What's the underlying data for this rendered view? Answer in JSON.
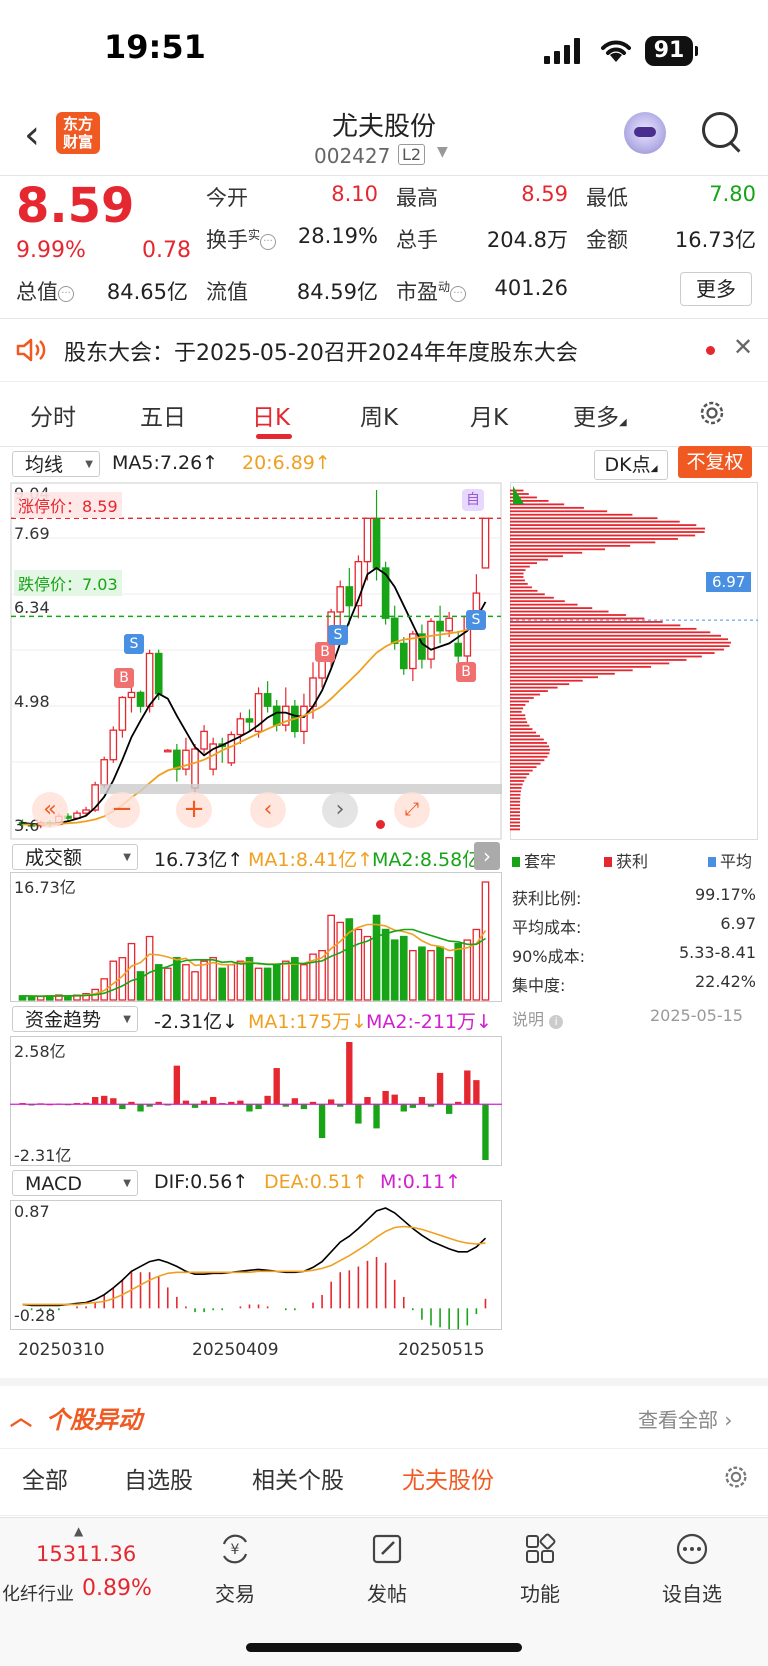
{
  "status_bar": {
    "time": "19:51",
    "battery": "91"
  },
  "header": {
    "logo_text_line1": "东方",
    "logo_text_line2": "财富",
    "stock_name": "尤夫股份",
    "stock_code": "002427",
    "level_badge": "L2"
  },
  "quote": {
    "price": "8.59",
    "change_pct": "9.99%",
    "change": "0.78",
    "open_label": "今开",
    "open_value": "8.10",
    "high_label": "最高",
    "high_value": "8.59",
    "low_label": "最低",
    "low_value": "7.80",
    "turnover_label": "换手",
    "turnover_sup": "实",
    "turnover_value": "28.19%",
    "volume_label": "总手",
    "volume_value": "204.8万",
    "amount_label": "金额",
    "amount_value": "16.73亿",
    "total_mv_label": "总值",
    "total_mv_value": "84.65亿",
    "float_mv_label": "流值",
    "float_mv_value": "84.59亿",
    "pe_label": "市盈",
    "pe_sup": "动",
    "pe_value": "401.26",
    "more_button": "更多"
  },
  "notice": {
    "text": "股东大会：于2025-05-20召开2024年年度股东大会"
  },
  "period_tabs": [
    {
      "label": "分时",
      "active": false
    },
    {
      "label": "五日",
      "active": false
    },
    {
      "label": "日K",
      "active": true
    },
    {
      "label": "周K",
      "active": false
    },
    {
      "label": "月K",
      "active": false
    },
    {
      "label": "更多",
      "active": false
    }
  ],
  "kline": {
    "ma_select": "均线",
    "ma5": "MA5:7.26↑",
    "ma20": "20:6.89↑",
    "dk_select": "DK点",
    "fq_button": "不复权",
    "y_labels": [
      "9.04",
      "7.69",
      "6.34",
      "4.98",
      "3.6"
    ],
    "limit_up_label": "涨停价：8.59",
    "limit_down_label": "跌停价：7.03",
    "self_marker": "自",
    "buy_marker": "B",
    "sell_marker": "S",
    "colors": {
      "up": "#e5272f",
      "down": "#17a417",
      "ma5": "#000000",
      "ma20": "#f0a020"
    }
  },
  "chip_profile": {
    "avg_price_label": "6.97",
    "legend": [
      "套牢",
      "获利",
      "平均"
    ],
    "stats": [
      {
        "label": "获利比例:",
        "value": "99.17%"
      },
      {
        "label": "平均成本:",
        "value": "6.97"
      },
      {
        "label": "90%成本:",
        "value": "5.33-8.41"
      },
      {
        "label": "集中度:",
        "value": "22.42%"
      }
    ],
    "note_label": "说明",
    "date": "2025-05-15"
  },
  "volume_panel": {
    "select": "成交额",
    "value": "16.73亿↑",
    "ma1": "MA1:8.41亿↑",
    "ma2": "MA2:8.58亿↑",
    "max_label": "16.73亿"
  },
  "capital_panel": {
    "select": "资金趋势",
    "value": "-2.31亿↓",
    "ma1": "MA1:175万↓",
    "ma2": "MA2:-211万↓",
    "max_label": "2.58亿",
    "min_label": "-2.31亿"
  },
  "macd_panel": {
    "select": "MACD",
    "dif": "DIF:0.56↑",
    "dea": "DEA:0.51↑",
    "m": "M:0.11↑",
    "max_label": "0.87",
    "min_label": "-0.28"
  },
  "x_axis_dates": [
    "20250310",
    "20250409",
    "20250515"
  ],
  "chart_data": {
    "type": "candlestick",
    "ylim": [
      3.6,
      9.04
    ],
    "candles": [
      {
        "o": 3.75,
        "c": 3.72,
        "h": 3.8,
        "l": 3.66
      },
      {
        "o": 3.72,
        "c": 3.7,
        "h": 3.76,
        "l": 3.65
      },
      {
        "o": 3.7,
        "c": 3.75,
        "h": 3.78,
        "l": 3.66
      },
      {
        "o": 3.75,
        "c": 3.72,
        "h": 3.79,
        "l": 3.68
      },
      {
        "o": 3.72,
        "c": 3.85,
        "h": 3.9,
        "l": 3.7
      },
      {
        "o": 3.85,
        "c": 3.82,
        "h": 3.9,
        "l": 3.78
      },
      {
        "o": 3.82,
        "c": 3.9,
        "h": 3.94,
        "l": 3.8
      },
      {
        "o": 3.9,
        "c": 3.95,
        "h": 4.0,
        "l": 3.86
      },
      {
        "o": 3.95,
        "c": 4.35,
        "h": 4.4,
        "l": 3.92
      },
      {
        "o": 4.35,
        "c": 4.75,
        "h": 4.8,
        "l": 4.3
      },
      {
        "o": 4.75,
        "c": 5.22,
        "h": 5.28,
        "l": 4.7
      },
      {
        "o": 5.22,
        "c": 5.74,
        "h": 5.76,
        "l": 5.1
      },
      {
        "o": 5.74,
        "c": 5.82,
        "h": 6.1,
        "l": 5.5
      },
      {
        "o": 5.82,
        "c": 5.6,
        "h": 5.85,
        "l": 5.5
      },
      {
        "o": 5.6,
        "c": 6.44,
        "h": 6.5,
        "l": 5.5
      },
      {
        "o": 6.44,
        "c": 5.8,
        "h": 6.5,
        "l": 5.7
      },
      {
        "o": 4.9,
        "c": 4.9,
        "h": 4.92,
        "l": 4.88
      },
      {
        "o": 4.9,
        "c": 4.6,
        "h": 5.0,
        "l": 4.4
      },
      {
        "o": 4.6,
        "c": 4.9,
        "h": 5.1,
        "l": 4.5
      },
      {
        "o": 4.3,
        "c": 4.92,
        "h": 5.0,
        "l": 4.2
      },
      {
        "o": 4.92,
        "c": 5.2,
        "h": 5.3,
        "l": 4.85
      },
      {
        "o": 4.6,
        "c": 5.0,
        "h": 5.1,
        "l": 4.5
      },
      {
        "o": 5.0,
        "c": 4.96,
        "h": 5.1,
        "l": 4.7
      },
      {
        "o": 4.7,
        "c": 5.15,
        "h": 5.2,
        "l": 4.65
      },
      {
        "o": 5.15,
        "c": 5.4,
        "h": 5.5,
        "l": 5.0
      },
      {
        "o": 5.4,
        "c": 5.35,
        "h": 5.55,
        "l": 5.2
      },
      {
        "o": 5.2,
        "c": 5.8,
        "h": 5.9,
        "l": 5.1
      },
      {
        "o": 5.8,
        "c": 5.6,
        "h": 6.0,
        "l": 5.5
      },
      {
        "o": 5.6,
        "c": 5.3,
        "h": 5.7,
        "l": 5.2
      },
      {
        "o": 5.3,
        "c": 5.6,
        "h": 5.9,
        "l": 5.2
      },
      {
        "o": 5.6,
        "c": 5.2,
        "h": 5.7,
        "l": 5.1
      },
      {
        "o": 5.2,
        "c": 5.6,
        "h": 5.8,
        "l": 5.0
      },
      {
        "o": 5.6,
        "c": 6.05,
        "h": 6.3,
        "l": 5.4
      },
      {
        "o": 6.05,
        "c": 6.5,
        "h": 6.6,
        "l": 5.9
      },
      {
        "o": 6.5,
        "c": 7.1,
        "h": 7.15,
        "l": 6.2
      },
      {
        "o": 7.1,
        "c": 7.5,
        "h": 7.6,
        "l": 6.8
      },
      {
        "o": 7.5,
        "c": 7.2,
        "h": 7.8,
        "l": 6.9
      },
      {
        "o": 7.2,
        "c": 7.9,
        "h": 8.0,
        "l": 7.0
      },
      {
        "o": 7.9,
        "c": 8.59,
        "h": 8.59,
        "l": 7.6
      },
      {
        "o": 8.59,
        "c": 7.8,
        "h": 9.04,
        "l": 7.6
      },
      {
        "o": 7.8,
        "c": 7.0,
        "h": 7.9,
        "l": 6.9
      },
      {
        "o": 7.0,
        "c": 6.6,
        "h": 7.2,
        "l": 6.5
      },
      {
        "o": 6.6,
        "c": 6.2,
        "h": 6.7,
        "l": 6.1
      },
      {
        "o": 6.2,
        "c": 6.75,
        "h": 6.8,
        "l": 6.0
      },
      {
        "o": 6.75,
        "c": 6.35,
        "h": 6.9,
        "l": 6.2
      },
      {
        "o": 6.35,
        "c": 6.95,
        "h": 7.0,
        "l": 6.2
      },
      {
        "o": 6.95,
        "c": 6.8,
        "h": 7.2,
        "l": 6.6
      },
      {
        "o": 6.8,
        "c": 7.0,
        "h": 7.1,
        "l": 6.7
      },
      {
        "o": 6.6,
        "c": 6.4,
        "h": 6.8,
        "l": 6.3
      },
      {
        "o": 6.4,
        "c": 7.03,
        "h": 7.1,
        "l": 6.3
      },
      {
        "o": 7.03,
        "c": 7.4,
        "h": 7.7,
        "l": 6.9
      },
      {
        "o": 7.8,
        "c": 8.59,
        "h": 8.59,
        "l": 7.8
      }
    ],
    "ma5": [
      3.74,
      3.73,
      3.72,
      3.72,
      3.75,
      3.77,
      3.81,
      3.86,
      3.99,
      4.16,
      4.42,
      4.75,
      5.11,
      5.37,
      5.62,
      5.8,
      5.72,
      5.45,
      5.2,
      4.95,
      4.82,
      4.92,
      4.98,
      5.05,
      5.12,
      5.2,
      5.3,
      5.42,
      5.5,
      5.5,
      5.45,
      5.43,
      5.6,
      5.85,
      6.2,
      6.6,
      6.95,
      7.3,
      7.7,
      7.8,
      7.7,
      7.5,
      7.2,
      6.9,
      6.6,
      6.5,
      6.55,
      6.6,
      6.7,
      6.8,
      7.0,
      7.26
    ],
    "ma20": [
      3.72,
      3.72,
      3.72,
      3.72,
      3.73,
      3.74,
      3.75,
      3.77,
      3.8,
      3.85,
      3.93,
      4.03,
      4.15,
      4.25,
      4.38,
      4.5,
      4.58,
      4.62,
      4.66,
      4.7,
      4.75,
      4.82,
      4.9,
      4.96,
      5.03,
      5.1,
      5.17,
      5.24,
      5.3,
      5.36,
      5.4,
      5.45,
      5.52,
      5.6,
      5.72,
      5.86,
      6.0,
      6.14,
      6.3,
      6.45,
      6.55,
      6.62,
      6.66,
      6.68,
      6.7,
      6.72,
      6.74,
      6.76,
      6.78,
      6.82,
      6.85,
      6.89
    ],
    "amount": [
      0.6,
      0.5,
      0.5,
      0.6,
      0.7,
      0.6,
      0.7,
      0.9,
      1.5,
      3.0,
      5.5,
      6.0,
      8.0,
      4.0,
      9.0,
      5.0,
      4.5,
      6.0,
      5.0,
      4.0,
      5.5,
      6.0,
      4.5,
      5.0,
      5.5,
      6.0,
      4.5,
      4.5,
      5.0,
      5.5,
      6.0,
      5.0,
      6.5,
      7.0,
      12.0,
      11.0,
      11.5,
      10.0,
      9.0,
      12.0,
      10.0,
      8.5,
      9.0,
      7.0,
      7.5,
      7.0,
      7.5,
      6.0,
      8.0,
      8.5,
      10.0,
      16.73
    ],
    "capital": [
      0.05,
      -0.05,
      0.04,
      0.0,
      0.03,
      -0.02,
      0.05,
      0.06,
      0.3,
      0.35,
      0.25,
      -0.2,
      0.1,
      -0.3,
      -0.1,
      0.1,
      -0.05,
      1.6,
      0.15,
      -0.15,
      0.15,
      0.3,
      0.05,
      0.1,
      0.15,
      -0.3,
      -0.2,
      0.35,
      1.5,
      -0.1,
      0.25,
      -0.2,
      0.1,
      -1.4,
      0.2,
      -0.1,
      2.58,
      -0.8,
      0.3,
      -1.0,
      0.55,
      0.4,
      -0.3,
      -0.15,
      0.3,
      -0.1,
      1.3,
      -0.4,
      0.1,
      1.4,
      1.0,
      -2.31
    ],
    "macd_dif": [
      -0.12,
      -0.13,
      -0.13,
      -0.13,
      -0.13,
      -0.12,
      -0.11,
      -0.1,
      -0.07,
      -0.02,
      0.05,
      0.13,
      0.22,
      0.27,
      0.32,
      0.34,
      0.31,
      0.27,
      0.22,
      0.19,
      0.19,
      0.2,
      0.2,
      0.21,
      0.22,
      0.23,
      0.24,
      0.23,
      0.22,
      0.21,
      0.21,
      0.22,
      0.26,
      0.32,
      0.42,
      0.52,
      0.58,
      0.66,
      0.75,
      0.84,
      0.87,
      0.82,
      0.74,
      0.66,
      0.59,
      0.53,
      0.49,
      0.45,
      0.42,
      0.42,
      0.47,
      0.56
    ],
    "macd_dea": [
      -0.12,
      -0.12,
      -0.12,
      -0.12,
      -0.12,
      -0.12,
      -0.12,
      -0.11,
      -0.1,
      -0.09,
      -0.06,
      -0.02,
      0.03,
      0.08,
      0.13,
      0.17,
      0.2,
      0.21,
      0.21,
      0.21,
      0.21,
      0.21,
      0.21,
      0.21,
      0.21,
      0.21,
      0.22,
      0.22,
      0.22,
      0.22,
      0.22,
      0.22,
      0.23,
      0.25,
      0.28,
      0.33,
      0.38,
      0.44,
      0.5,
      0.57,
      0.63,
      0.67,
      0.68,
      0.67,
      0.65,
      0.62,
      0.59,
      0.56,
      0.53,
      0.51,
      0.5,
      0.51
    ],
    "chip_avg": 6.97
  }
}
